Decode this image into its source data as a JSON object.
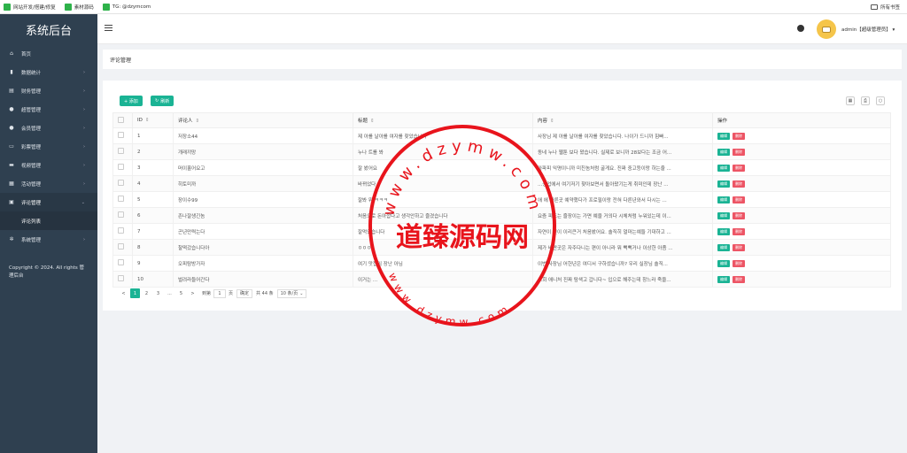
{
  "bookmarks": {
    "items": [
      {
        "icon": "bookmark-icon",
        "label": "网站开发/搭建/修复"
      },
      {
        "icon": "bookmark-icon",
        "label": "素材源码"
      },
      {
        "icon": "bookmark-icon",
        "label": "TG: @dzymcom"
      }
    ],
    "all_bookmarks": "所有书签"
  },
  "sidebar": {
    "title": "系统后台",
    "items": [
      {
        "icon": "home-icon",
        "label": "首页"
      },
      {
        "icon": "bar-chart-icon",
        "label": "数据统计"
      },
      {
        "icon": "finance-icon",
        "label": "财务管理"
      },
      {
        "icon": "user-icon",
        "label": "超管管理"
      },
      {
        "icon": "member-icon",
        "label": "会员管理"
      },
      {
        "icon": "game-icon",
        "label": "彩票管理"
      },
      {
        "icon": "video-icon",
        "label": "视频管理"
      },
      {
        "icon": "bulletin-icon",
        "label": "活动管理"
      },
      {
        "icon": "comment-icon",
        "label": "评论管理"
      },
      {
        "icon": "settings-icon",
        "label": "系统管理"
      }
    ],
    "sub_item": "评论列表",
    "copyright": "Copyright © 2024. All rights 管理后台"
  },
  "header": {
    "user": "admin【超级管理员】"
  },
  "page_title": "评论管理",
  "toolbar": {
    "add_label": "+ 添加",
    "refresh_label": "刷新"
  },
  "table": {
    "headers": [
      "ID",
      "评论人",
      "标题",
      "内容",
      "操作"
    ],
    "edit_label": "编辑",
    "delete_label": "删除",
    "rows": [
      {
        "id": "1",
        "name": "저장소44",
        "title": "제 아를 날아를 여자를 찾았습니다",
        "content": "사장님 제 아를 날아를 여자를 찾았습니다. 나이가 드니까 힘빠..."
      },
      {
        "id": "2",
        "name": "개래끼망",
        "title": "누나 트를 봐",
        "content": "동네 누나 웹툰 보다 왔습니다. 실제로 보니까 28보다는 조금 어..."
      },
      {
        "id": "3",
        "name": "머이홀어요고",
        "title": "잘 봤어요",
        "content": "아파피 익명이니까 미친놈처럼 굴게요. 진짜 중고등이랑 하는줄 ..."
      },
      {
        "id": "4",
        "name": "히토미까",
        "title": "바뀌었다",
        "content": "...생업에서 여기저기 찾아보면서 돌아왔기는게 취미인데 장난 ..."
      },
      {
        "id": "5",
        "name": "장이수99",
        "title": "잘봐 뭐 ㅋㅋㅋ",
        "content": "애 에 다른곳 예약했다가 프로필이랑 전혀 다른년와서 다시는 ..."
      },
      {
        "id": "6",
        "name": "존나잘생긴놈",
        "title": "처음으로 돈아깝다고 생각안하고 즐겼습니다",
        "content": "요즘 피드는 즐장이는 가면 예을 거의다 시체처럼 누워있는데 이..."
      },
      {
        "id": "7",
        "name": "곤년만력는다",
        "title": "잘먹었습니다",
        "content": "자연이 젖이 이리큰거 처음봤어요. 솔직히 얼마는예들 기대하고 ..."
      },
      {
        "id": "8",
        "name": "찰떡갔습니다아",
        "title": "ㅇㅇㅇ",
        "content": "제가 비싼곳은 자주다니는 편이 아니라 뭐 뻑뻑거나 이상한 아좀 ..."
      },
      {
        "id": "9",
        "name": "오피탐방가자",
        "title": "여기 맛집임 장난 아님",
        "content": "이번 사장님 어헌년은 여디서 구하셨습니까? 우리 실장님 솔직..."
      },
      {
        "id": "10",
        "name": "벌려라들어간다",
        "title": "이거는 ...",
        "content": "...회 애니처 진짜 탐색고 갑니다~ 입으로 해주는데 창느라 죽을..."
      }
    ]
  },
  "pagination": {
    "prev": "<",
    "pages": [
      "1",
      "2",
      "3",
      "...",
      "5"
    ],
    "next": ">",
    "goto_label": "到第",
    "goto_value": "1",
    "page_unit": "页",
    "confirm": "确定",
    "total": "共 44 条",
    "page_size": "10 条/页"
  },
  "watermark": {
    "center_text": "道臻源码网",
    "ring_text_top": "www.dzymw.com",
    "ring_text_bottom": "www.dzymw.com",
    "color": "#e8141c"
  }
}
